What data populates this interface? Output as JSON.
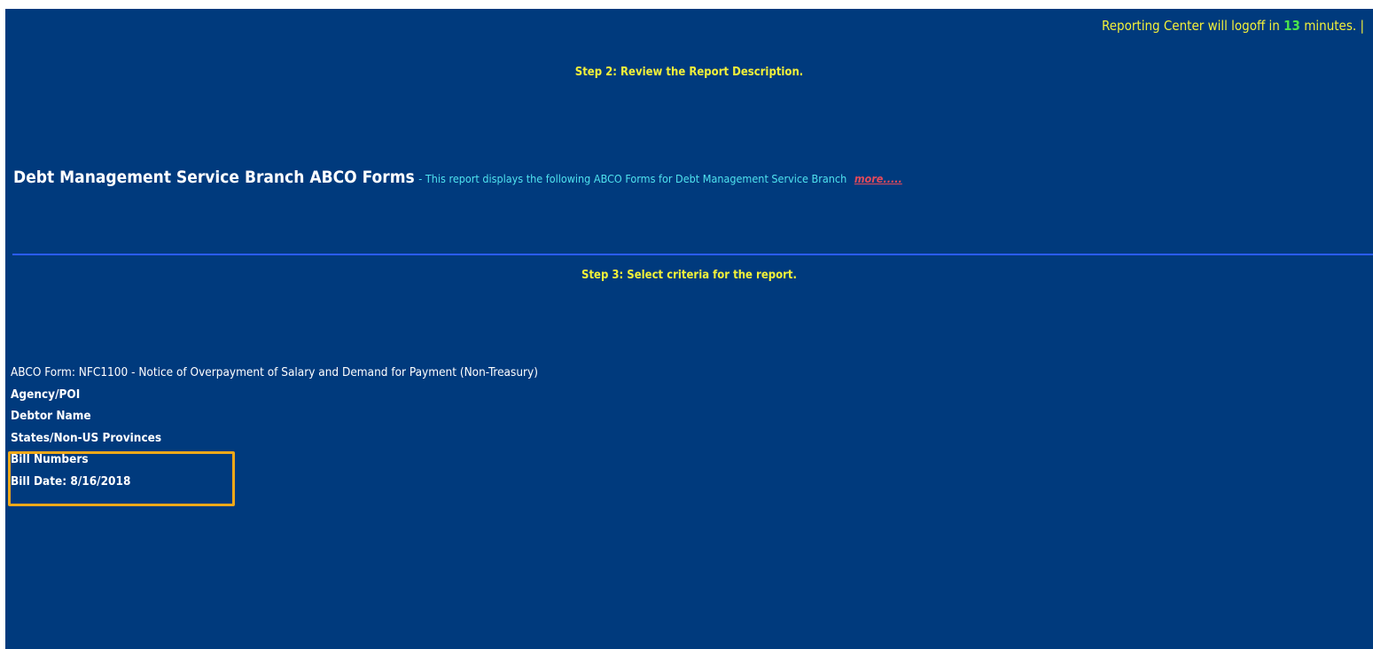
{
  "header": {
    "logoff_prefix": "Reporting Center will logoff in",
    "logoff_minutes": "13",
    "logoff_suffix": "minutes. |"
  },
  "step2": {
    "label": "Step 2: Review the Report Description."
  },
  "report": {
    "title": "Debt Management Service Branch ABCO Forms",
    "description": "- This report displays the following ABCO Forms for Debt Management Service Branch",
    "more_link": "more....."
  },
  "step3": {
    "label": "Step 3: Select criteria for the report."
  },
  "criteria": [
    {
      "label": "ABCO Form: NFC1100 - Notice of Overpayment of Salary and Demand for Payment (Non-Treasury)"
    },
    {
      "label": "Agency/POI"
    },
    {
      "label": "Debtor Name"
    },
    {
      "label": "States/Non-US Provinces"
    },
    {
      "label": "Bill Numbers"
    },
    {
      "label": "Bill Date: 8/16/2018"
    }
  ],
  "colors": {
    "background": "#003a7d",
    "step_text": "#f3f03a",
    "minutes_number": "#4be24b",
    "description_text": "#4fe3f0",
    "more_link": "#e2495a",
    "divider": "#2a5cff",
    "highlight_box": "#f0a818"
  }
}
